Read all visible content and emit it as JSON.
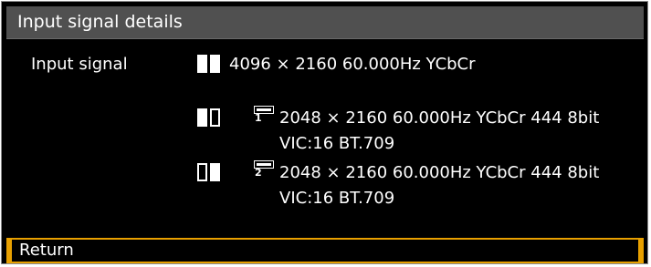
{
  "title": "Input signal details",
  "input_signal": {
    "label": "Input signal",
    "value": "4096 × 2160 60.000Hz YCbCr"
  },
  "sub_signals": [
    {
      "hdmi_number": "1",
      "line1": "2048 × 2160 60.000Hz YCbCr 444 8bit",
      "line2": "VIC:16 BT.709"
    },
    {
      "hdmi_number": "2",
      "line1": "2048 × 2160 60.000Hz YCbCr 444 8bit",
      "line2": "VIC:16 BT.709"
    }
  ],
  "return_label": "Return",
  "colors": {
    "background": "#000000",
    "titlebar": "#505050",
    "highlight": "#e8a000",
    "text": "#ffffff"
  },
  "icons": [
    "dual-signal-icon",
    "left-half-signal-icon",
    "right-half-signal-icon",
    "hdmi-icon"
  ]
}
